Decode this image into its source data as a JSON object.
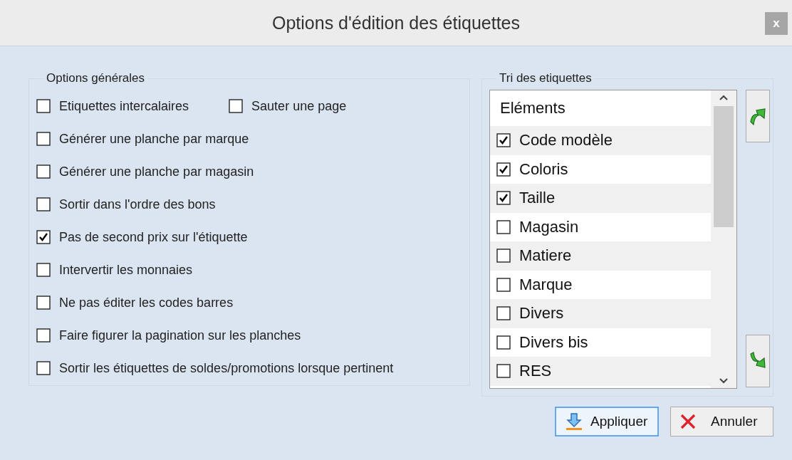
{
  "window": {
    "title": "Options d'édition des étiquettes",
    "close": "x"
  },
  "general_options": {
    "title": "Options générales",
    "rows": [
      [
        {
          "label": "Etiquettes intercalaires",
          "checked": false
        },
        {
          "label": "Sauter une page",
          "checked": false
        }
      ],
      [
        {
          "label": "Générer une planche par marque",
          "checked": false
        }
      ],
      [
        {
          "label": "Générer une planche par magasin",
          "checked": false
        }
      ],
      [
        {
          "label": "Sortir dans l'ordre des bons",
          "checked": false
        }
      ],
      [
        {
          "label": "Pas de second prix sur l'étiquette",
          "checked": true
        }
      ],
      [
        {
          "label": "Intervertir les monnaies",
          "checked": false
        }
      ],
      [
        {
          "label": "Ne pas éditer les codes barres",
          "checked": false
        }
      ],
      [
        {
          "label": "Faire figurer la pagination sur les planches",
          "checked": false
        }
      ],
      [
        {
          "label": "Sortir les étiquettes de soldes/promotions lorsque pertinent",
          "checked": false
        }
      ]
    ]
  },
  "sort": {
    "title": "Tri des etiquettes",
    "column": "Eléments",
    "items": [
      {
        "label": "Code modèle",
        "checked": true
      },
      {
        "label": "Coloris",
        "checked": true
      },
      {
        "label": "Taille",
        "checked": true
      },
      {
        "label": "Magasin",
        "checked": false
      },
      {
        "label": "Matiere",
        "checked": false
      },
      {
        "label": "Marque",
        "checked": false
      },
      {
        "label": "Divers",
        "checked": false
      },
      {
        "label": "Divers bis",
        "checked": false
      },
      {
        "label": "RES",
        "checked": false
      }
    ]
  },
  "buttons": [
    {
      "kind": "apply",
      "label": "Appliquer"
    },
    {
      "kind": "cancel",
      "label": "Annuler"
    }
  ]
}
